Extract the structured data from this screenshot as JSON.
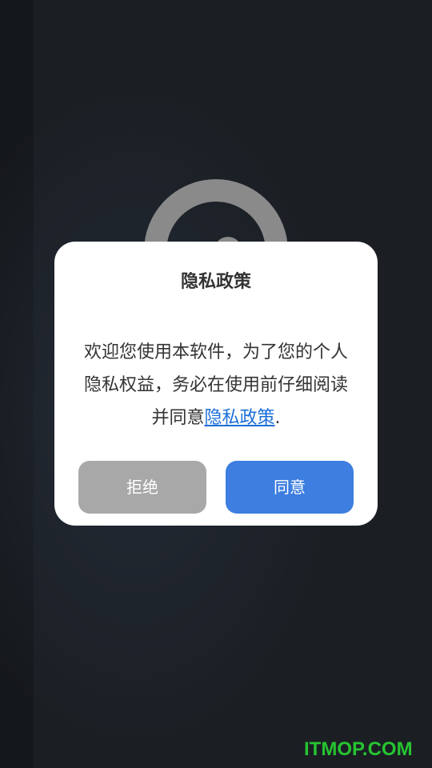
{
  "dialog": {
    "title": "隐私政策",
    "message_before_link": "欢迎您使用本软件，为了您的个人隐私权益，务必在使用前仔细阅读并同意",
    "link_text": "隐私政策",
    "message_after_link": ".",
    "reject_label": "拒绝",
    "agree_label": "同意"
  },
  "watermark": {
    "text": "ITMOP.COM"
  },
  "colors": {
    "background": "#1b1f23",
    "splash_logo": "#8a8a8a",
    "dialog_background": "#ffffff",
    "reject_button": "#a8a8a8",
    "agree_button": "#3d7ee0",
    "link": "#1a6fd8",
    "watermark": "#26c430"
  }
}
